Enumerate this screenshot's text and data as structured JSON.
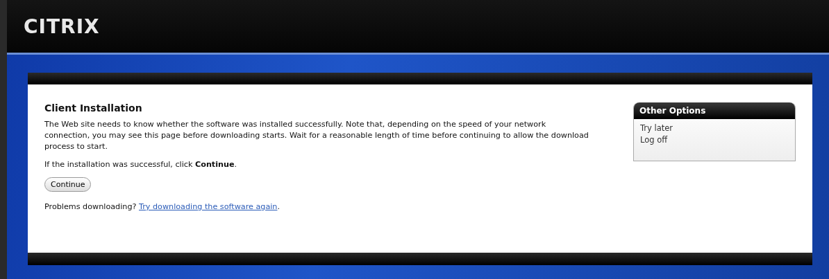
{
  "header": {
    "logo": "CITRIX"
  },
  "main": {
    "title": "Client Installation",
    "paragraphs": [
      "The Web site needs to know whether the software was installed successfully. Note that, depending on the speed of your network connection, you may see this page before downloading starts. Wait for a reasonable length of time before continuing to allow the download process to start.",
      "If the installation was successful, click **Continue**."
    ],
    "button": "Continue",
    "problem": {
      "text": "Problems downloading?",
      "link": "Try downloading the software again",
      "suffix": "."
    }
  },
  "sidebar": {
    "title": "Other Options",
    "items": [
      "Try later",
      "Log off"
    ]
  }
}
